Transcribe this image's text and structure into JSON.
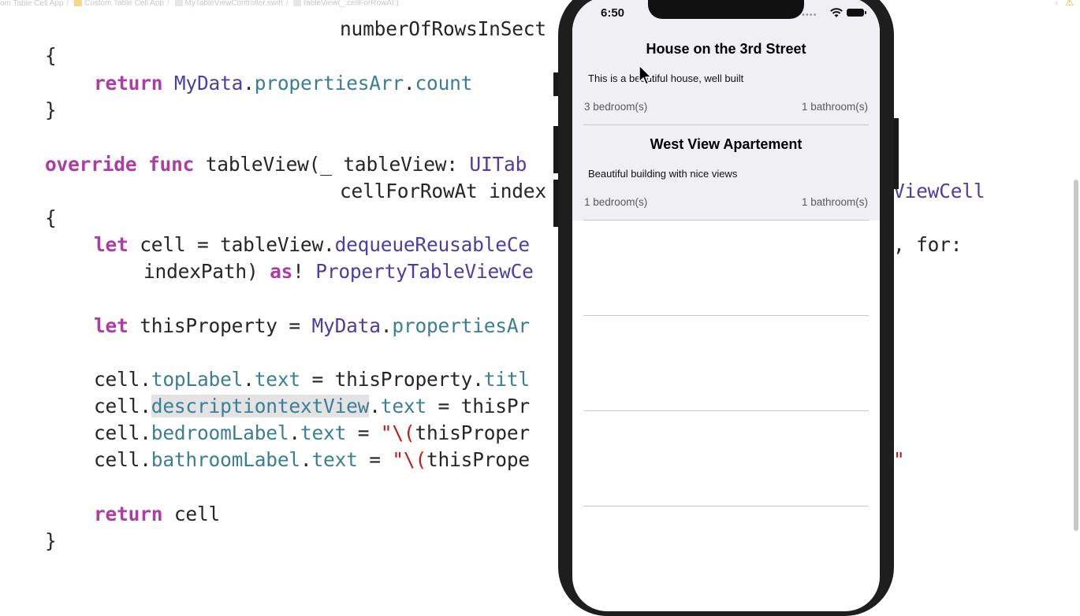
{
  "breadcrumb": [
    "om Table Cell App",
    "Custom Table Cell App",
    "MyTableViewController.swift",
    "tableView(_:cellForRowAt:)"
  ],
  "code": {
    "l1": "numberOfRowsInSect",
    "l2": "{",
    "l3_kw": "return",
    "l3_ty": "MyData",
    "l3_pr": "propertiesArr",
    "l3_pr2": "count",
    "l4": "}",
    "l5_kw1": "override",
    "l5_kw2": "func",
    "l5_name": "tableView(_ tableView: ",
    "l5_ty": "UITab",
    "l6": "cellForRowAt index",
    "l6_right": "ViewCell",
    "l7": "{",
    "l8_kw": "let",
    "l8_mid": "cell = tableView.",
    "l8_call": "dequeueReusableCe",
    "l8_right": ", for:",
    "l9_mid": "indexPath) ",
    "l9_kw": "as",
    "l9_bang": "! ",
    "l9_ty": "PropertyTableViewCe",
    "l10_kw": "let",
    "l10_mid": "thisProperty = ",
    "l10_ty": "MyData",
    "l10_pr": "propertiesAr",
    "l11_a": "cell.",
    "l11_pr": "topLabel",
    "l11_pr2": "text",
    "l11_b": " = thisProperty.",
    "l11_pr3": "titl",
    "l12_pr": "descriptiontextView",
    "l12_b": " = thisPr",
    "l13_pr": "bedroomLabel",
    "l13_b": " = ",
    "l13_str": "\"\\(",
    "l13_c": "thisProper",
    "l14_pr": "bathroomLabel",
    "l14_c": "thisPrope",
    "l14_right": "\"",
    "l15_kw": "return",
    "l15_b": " cell",
    "l16": "}"
  },
  "phone": {
    "time": "6:50",
    "cells": [
      {
        "title": "House on the 3rd Street",
        "description": "This is a beautiful house, well built",
        "bedrooms": "3 bedroom(s)",
        "bathrooms": "1 bathroom(s)"
      },
      {
        "title": "West View Apartement",
        "description": "Beautiful building with nice views",
        "bedrooms": "1 bedroom(s)",
        "bathrooms": "1 bathroom(s)"
      }
    ]
  }
}
